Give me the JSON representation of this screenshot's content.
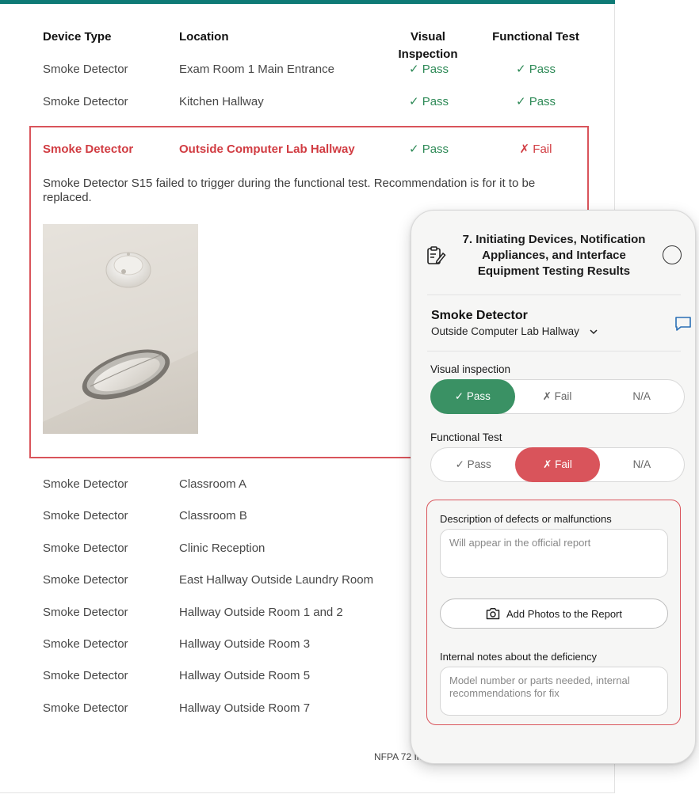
{
  "table": {
    "headers": {
      "device_type": "Device Type",
      "location": "Location",
      "visual": "Visual Inspection",
      "functional": "Functional Test"
    },
    "rows_top": [
      {
        "type": "Smoke Detector",
        "location": "Exam Room 1 Main Entrance",
        "visual": "✓ Pass",
        "functional": "✓ Pass"
      },
      {
        "type": "Smoke Detector",
        "location": "Kitchen Hallway",
        "visual": "✓ Pass",
        "functional": "✓ Pass"
      }
    ],
    "highlighted": {
      "type": "Smoke Detector",
      "location": "Outside Computer Lab Hallway",
      "visual": "✓ Pass",
      "functional": "✗ Fail",
      "note": "Smoke Detector S15 failed to trigger during the functional test. Recommendation is for it to be replaced."
    },
    "rows_bottom": [
      {
        "type": "Smoke Detector",
        "location": "Classroom A"
      },
      {
        "type": "Smoke Detector",
        "location": "Classroom B"
      },
      {
        "type": "Smoke Detector",
        "location": "Clinic Reception"
      },
      {
        "type": "Smoke Detector",
        "location": "East Hallway Outside Laundry Room"
      },
      {
        "type": "Smoke Detector",
        "location": "Hallway Outside Room 1 and 2"
      },
      {
        "type": "Smoke Detector",
        "location": "Hallway Outside Room 3"
      },
      {
        "type": "Smoke Detector",
        "location": "Hallway Outside Room 5"
      },
      {
        "type": "Smoke Detector",
        "location": "Hallway Outside Room 7"
      }
    ],
    "footer": "NFPA 72 In"
  },
  "phone": {
    "section_title": "7. Initiating Devices, Notification Appliances, and Interface Equipment Testing Results",
    "device": "Smoke Detector",
    "location": "Outside Computer Lab Hallway",
    "visual_label": "Visual inspection",
    "functional_label": "Functional Test",
    "options": {
      "pass": "✓ Pass",
      "fail": "✗ Fail",
      "na": "N/A"
    },
    "visual_selected": "pass",
    "functional_selected": "fail",
    "defects": {
      "description_label": "Description of defects or malfunctions",
      "description_placeholder": "Will appear in the official report",
      "add_photos": "Add Photos to the Report",
      "notes_label": "Internal notes about the deficiency",
      "notes_placeholder": "Model number or parts needed, internal recommendations for fix"
    }
  },
  "colors": {
    "accent": "#0f7a76",
    "pass": "#2e8a57",
    "fail": "#d13c42",
    "pass_button": "#3a9164",
    "fail_button": "#d9545b"
  }
}
